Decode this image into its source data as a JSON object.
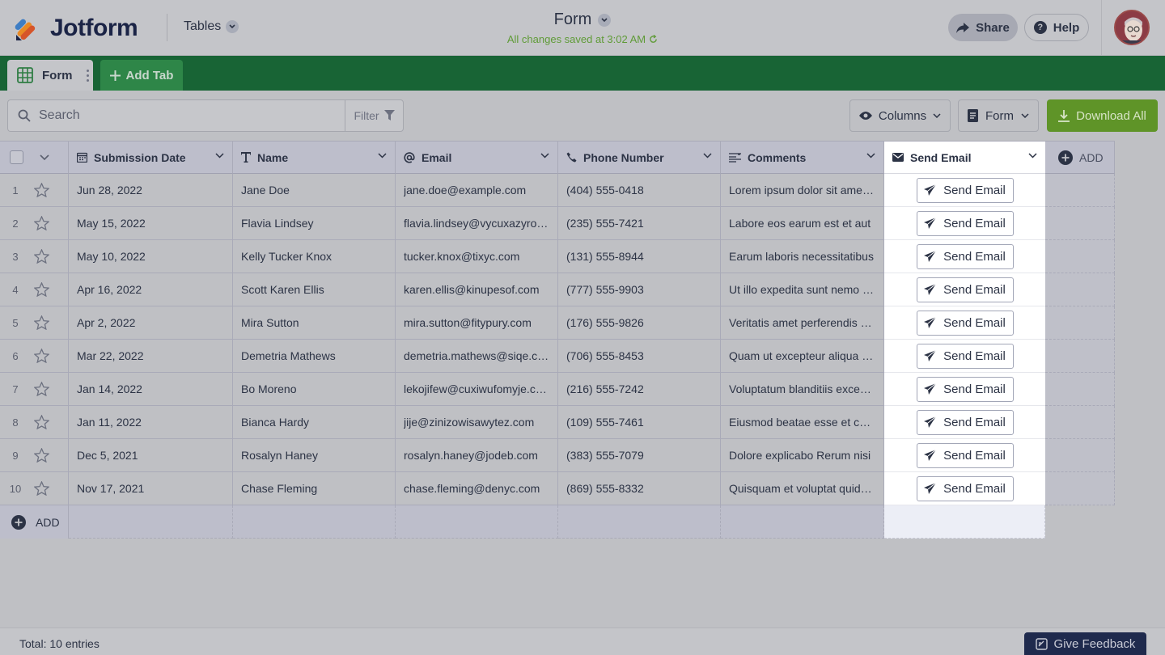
{
  "app": {
    "brand": "Jotform",
    "section": "Tables"
  },
  "title": {
    "name": "Form",
    "saved_status": "All changes saved at 3:02 AM"
  },
  "header_actions": {
    "share": "Share",
    "help": "Help"
  },
  "tabs": {
    "active": "Form",
    "add": "Add Tab"
  },
  "toolbar": {
    "search_placeholder": "Search",
    "filter": "Filter",
    "columns": "Columns",
    "view": "Form",
    "download": "Download All"
  },
  "columns": [
    {
      "label": "Submission Date",
      "icon": "calendar-icon"
    },
    {
      "label": "Name",
      "icon": "text-icon"
    },
    {
      "label": "Email",
      "icon": "at-icon"
    },
    {
      "label": "Phone Number",
      "icon": "phone-icon"
    },
    {
      "label": "Comments",
      "icon": "paragraph-icon"
    },
    {
      "label": "Send Email",
      "icon": "envelope-icon"
    }
  ],
  "add_column": "ADD",
  "rows": [
    {
      "n": "1",
      "date": "Jun 28, 2022",
      "name": "Jane Doe",
      "email": "jane.doe@example.com",
      "phone": "(404) 555-0418",
      "comments": "Lorem ipsum dolor sit amet, consectetur",
      "action": "Send Email"
    },
    {
      "n": "2",
      "date": "May 15, 2022",
      "name": "Flavia Lindsey",
      "email": "flavia.lindsey@vycuxazyrow.com",
      "phone": "(235) 555-7421",
      "comments": "Labore eos earum est et aut",
      "action": "Send Email"
    },
    {
      "n": "3",
      "date": "May 10, 2022",
      "name": "Kelly Tucker Knox",
      "email": "tucker.knox@tixyc.com",
      "phone": "(131) 555-8944",
      "comments": "Earum laboris necessitatibus",
      "action": "Send Email"
    },
    {
      "n": "4",
      "date": "Apr 16, 2022",
      "name": "Scott Karen Ellis",
      "email": "karen.ellis@kinupesof.com",
      "phone": "(777) 555-9903",
      "comments": "Ut illo expedita sunt nemo quia",
      "action": "Send Email"
    },
    {
      "n": "5",
      "date": "Apr 2, 2022",
      "name": "Mira Sutton",
      "email": "mira.sutton@fitypury.com",
      "phone": "(176) 555-9826",
      "comments": "Veritatis amet perferendis est",
      "action": "Send Email"
    },
    {
      "n": "6",
      "date": "Mar 22, 2022",
      "name": "Demetria Mathews",
      "email": "demetria.mathews@siqe.com",
      "phone": "(706) 555-8453",
      "comments": "Quam ut excepteur aliqua est",
      "action": "Send Email"
    },
    {
      "n": "7",
      "date": "Jan 14, 2022",
      "name": "Bo Moreno",
      "email": "lekojifew@cuxiwufomyje.com",
      "phone": "(216) 555-7242",
      "comments": "Voluptatum blanditiis excepturi",
      "action": "Send Email"
    },
    {
      "n": "8",
      "date": "Jan 11, 2022",
      "name": "Bianca Hardy",
      "email": "jije@zinizowisawytez.com",
      "phone": "(109) 555-7461",
      "comments": "Eiusmod beatae esse et consequat",
      "action": "Send Email"
    },
    {
      "n": "9",
      "date": "Dec 5, 2021",
      "name": "Rosalyn Haney",
      "email": "rosalyn.haney@jodeb.com",
      "phone": "(383) 555-7079",
      "comments": "Dolore explicabo Rerum nisi",
      "action": "Send Email"
    },
    {
      "n": "10",
      "date": "Nov 17, 2021",
      "name": "Chase Fleming",
      "email": "chase.fleming@denyc.com",
      "phone": "(869) 555-8332",
      "comments": "Quisquam et voluptat quidem",
      "action": "Send Email"
    }
  ],
  "add_row": "ADD",
  "footer": {
    "total": "Total: 10 entries",
    "feedback": "Give Feedback"
  },
  "colors": {
    "green": "#186435",
    "download": "#5f9428",
    "navy": "#1f2a4d",
    "saved": "#5f9b37"
  }
}
